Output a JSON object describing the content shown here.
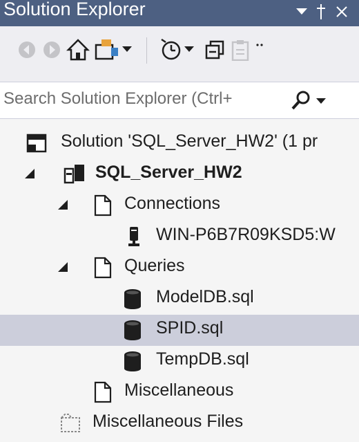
{
  "window": {
    "title": "Solution Explorer",
    "pin_glyph": "▾ ↕",
    "close_glyph": "✕"
  },
  "toolbar": {
    "buttons": [
      "back-icon",
      "forward-icon",
      "home-icon",
      "switch-views-icon",
      "dropdown-icon",
      "pending-changes-filter-icon",
      "dropdown-icon",
      "collapse-all-icon",
      "properties-icon",
      "overflow-icon"
    ]
  },
  "search": {
    "placeholder": "Search Solution Explorer (Ctrl+",
    "icon": "search-icon"
  },
  "tree": {
    "solution": "Solution 'SQL_Server_HW2' (1 pr",
    "project": "SQL_Server_HW2",
    "connections": "Connections",
    "connection_item": "WIN-P6B7R09KSD5:W",
    "queries": "Queries",
    "query_items": [
      "ModelDB.sql",
      "SPID.sql",
      "TempDB.sql"
    ],
    "miscellaneous": "Miscellaneous",
    "misc_files": "Miscellaneous Files",
    "selected": "SPID.sql"
  },
  "colors": {
    "title_bar": "#4d6082",
    "toolbar": "#eeeef2",
    "selection": "#cccedb",
    "accent_gold": "#e8a33c"
  }
}
